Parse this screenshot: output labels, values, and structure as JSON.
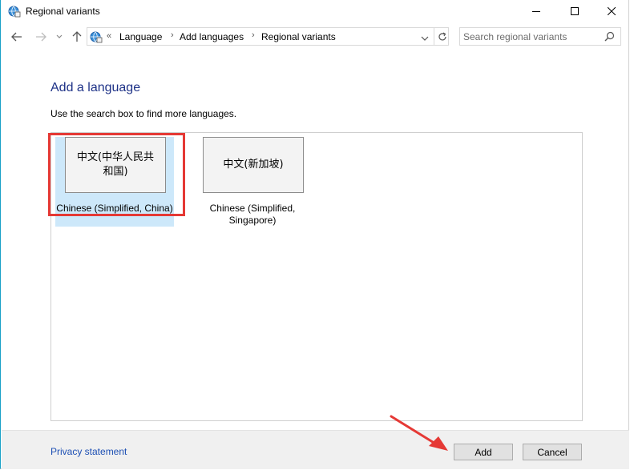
{
  "window": {
    "title": "Regional variants"
  },
  "address_bar": {
    "overflow": "«",
    "breadcrumbs": [
      "Language",
      "Add languages",
      "Regional variants"
    ]
  },
  "search": {
    "placeholder": "Search regional variants"
  },
  "content": {
    "heading": "Add a language",
    "instruction": "Use the search box to find more languages."
  },
  "languages": [
    {
      "tile": "中文(中华人民共和国)",
      "label": "Chinese (Simplified, China)",
      "selected": true
    },
    {
      "tile": "中文(新加坡)",
      "label": "Chinese (Simplified, Singapore)",
      "selected": false
    }
  ],
  "footer": {
    "privacy_link": "Privacy statement",
    "add_label": "Add",
    "cancel_label": "Cancel"
  },
  "colors": {
    "heading": "#1e3287",
    "link": "#1e50b4",
    "selection": "#cde8fa",
    "annotation": "#e53935"
  },
  "icons": [
    "globe-icon",
    "minimize-icon",
    "maximize-icon",
    "close-icon",
    "back-arrow-icon",
    "forward-arrow-icon",
    "chevron-down-icon",
    "up-arrow-icon",
    "refresh-icon",
    "search-icon"
  ]
}
